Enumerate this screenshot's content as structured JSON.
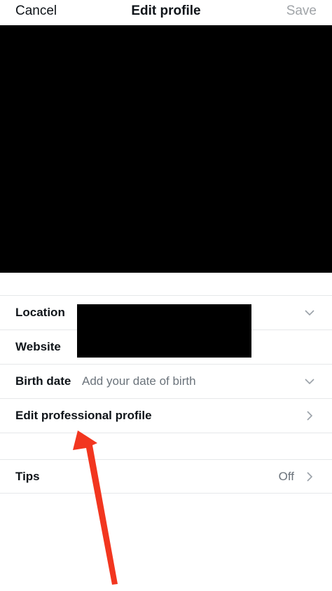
{
  "navbar": {
    "cancel_label": "Cancel",
    "title": "Edit profile",
    "save_label": "Save"
  },
  "fields": {
    "location_label": "Location",
    "website_label": "Website",
    "birth_date_label": "Birth date",
    "birth_date_placeholder": "Add your date of birth",
    "professional_label": "Edit professional profile"
  },
  "tips": {
    "label": "Tips",
    "value": "Off"
  },
  "icons": {
    "chevron_down": "chevron-down-icon",
    "chevron_right": "chevron-right-icon"
  },
  "colors": {
    "annotation_arrow": "#f2361f",
    "disabled_text": "#a0a4a8",
    "secondary_text": "#6b737b"
  }
}
